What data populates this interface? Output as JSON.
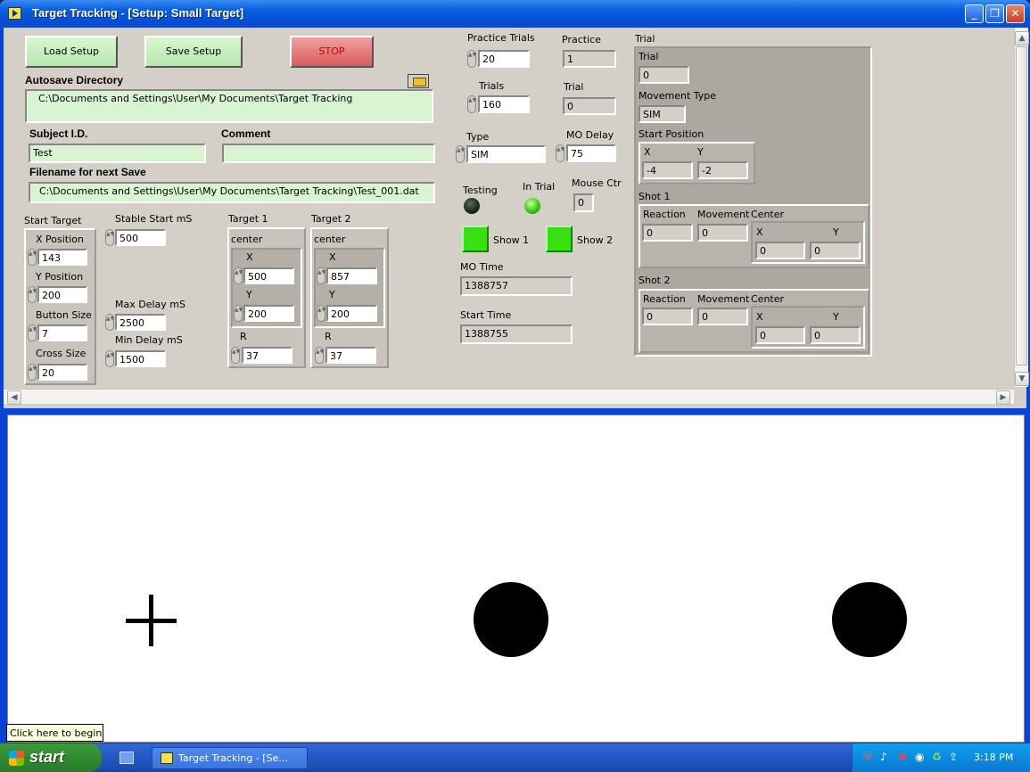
{
  "window": {
    "title": "Target Tracking - [Setup: Small Target]"
  },
  "buttons": {
    "load": "Load Setup",
    "save": "Save Setup",
    "stop": "STOP"
  },
  "autosave": {
    "label": "Autosave Directory",
    "value": "C:\\Documents and Settings\\User\\My Documents\\Target Tracking"
  },
  "subject": {
    "label": "Subject I.D.",
    "value": "Test"
  },
  "comment": {
    "label": "Comment",
    "value": ""
  },
  "filename": {
    "label": "Filename for next Save",
    "value": "C:\\Documents and Settings\\User\\My Documents\\Target Tracking\\Test_001.dat"
  },
  "start_target": {
    "label": "Start Target",
    "x_label": "X Position",
    "x": "143",
    "y_label": "Y Position",
    "y": "200",
    "button_label": "Button Size",
    "button": "7",
    "cross_label": "Cross Size",
    "cross": "20"
  },
  "delays": {
    "stable_label": "Stable Start mS",
    "stable": "500",
    "max_label": "Max Delay mS",
    "max": "2500",
    "min_label": "Min Delay mS",
    "min": "1500"
  },
  "target1": {
    "label": "Target 1",
    "center": "center",
    "x_label": "X",
    "x": "500",
    "y_label": "Y",
    "y": "200",
    "r_label": "R",
    "r": "37"
  },
  "target2": {
    "label": "Target 2",
    "center": "center",
    "x_label": "X",
    "x": "857",
    "y_label": "Y",
    "y": "200",
    "r_label": "R",
    "r": "37"
  },
  "trials": {
    "practice_trials_label": "Practice Trials",
    "practice_trials": "20",
    "practice_label": "Practice",
    "practice": "1",
    "trials_label": "Trials",
    "trials": "160",
    "trial_label": "Trial",
    "trial": "0",
    "type_label": "Type",
    "type": "SIM",
    "mo_delay_label": "MO Delay",
    "mo_delay": "75"
  },
  "status": {
    "testing_label": "Testing",
    "in_trial_label": "In Trial",
    "mouse_ctr_label": "Mouse Ctr",
    "mouse_ctr": "0",
    "show1_label": "Show 1",
    "show2_label": "Show 2",
    "mo_time_label": "MO Time",
    "mo_time": "1388757",
    "start_time_label": "Start Time",
    "start_time": "1388755"
  },
  "trial_panel": {
    "outer_label": "Trial",
    "trial_label": "Trial",
    "trial": "0",
    "movement_type_label": "Movement Type",
    "movement_type": "SIM",
    "start_pos_label": "Start Position",
    "x_label": "X",
    "x": "-4",
    "y_label": "Y",
    "y": "-2",
    "shot1": {
      "label": "Shot 1",
      "reaction_label": "Reaction",
      "reaction": "0",
      "movement_label": "Movement",
      "movement": "0",
      "center_label": "Center",
      "x_label": "X",
      "x": "0",
      "y_label": "Y",
      "y": "0"
    },
    "shot2": {
      "label": "Shot 2",
      "reaction_label": "Reaction",
      "reaction": "0",
      "movement_label": "Movement",
      "movement": "0",
      "center_label": "Center",
      "x_label": "X",
      "x": "0",
      "y_label": "Y",
      "y": "0"
    }
  },
  "taskbar": {
    "start": "start",
    "task": "Target Tracking - [Se...",
    "clock": "3:18 PM",
    "tooltip": "Click here to begin"
  }
}
